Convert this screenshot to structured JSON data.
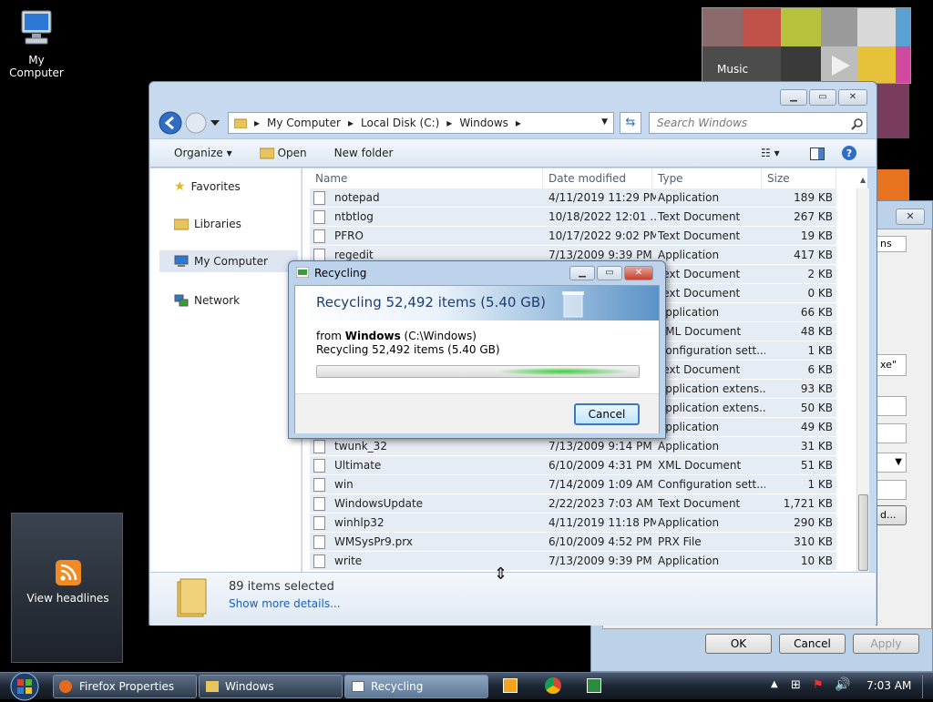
{
  "desktop": {
    "icons": [
      {
        "label": "My Computer"
      }
    ],
    "media_gadget": {
      "label": "Music"
    },
    "feed_gadget": {
      "label": "View headlines"
    }
  },
  "properties_window": {
    "tab_fragment": "ns",
    "field_fragment": "xe\"",
    "button_fragment": "d...",
    "ok_label": "OK",
    "cancel_label": "Cancel",
    "apply_label": "Apply"
  },
  "explorer": {
    "breadcrumb": [
      "My Computer",
      "Local Disk (C:)",
      "Windows"
    ],
    "search_placeholder": "Search Windows",
    "toolbar": {
      "organize_label": "Organize",
      "open_label": "Open",
      "new_folder_label": "New folder"
    },
    "nav_items": [
      {
        "label": "Favorites"
      },
      {
        "label": "Libraries"
      },
      {
        "label": "My Computer"
      },
      {
        "label": "Network"
      }
    ],
    "columns": [
      "Name",
      "Date modified",
      "Type",
      "Size"
    ],
    "rows": [
      {
        "name": "notepad",
        "date": "4/11/2019 11:29 PM",
        "type": "Application",
        "size": "189 KB"
      },
      {
        "name": "ntbtlog",
        "date": "10/18/2022 12:01 ...",
        "type": "Text Document",
        "size": "267 KB"
      },
      {
        "name": "PFRO",
        "date": "10/17/2022 9:02 PM",
        "type": "Text Document",
        "size": "19 KB"
      },
      {
        "name": "regedit",
        "date": "7/13/2009 9:39 PM",
        "type": "Application",
        "size": "417 KB"
      },
      {
        "name": "",
        "date": "",
        "type": "Text Document",
        "size": "2 KB"
      },
      {
        "name": "",
        "date": "",
        "type": "Text Document",
        "size": "0 KB"
      },
      {
        "name": "",
        "date": "",
        "type": "Application",
        "size": "66 KB"
      },
      {
        "name": "",
        "date": "",
        "type": "XML Document",
        "size": "48 KB"
      },
      {
        "name": "",
        "date": "",
        "type": "Configuration sett...",
        "size": "1 KB"
      },
      {
        "name": "",
        "date": "",
        "type": "Text Document",
        "size": "6 KB"
      },
      {
        "name": "",
        "date": "",
        "type": "Application extens...",
        "size": "93 KB"
      },
      {
        "name": "",
        "date": "",
        "type": "Application extens...",
        "size": "50 KB"
      },
      {
        "name": "",
        "date": "",
        "type": "Application",
        "size": "49 KB"
      },
      {
        "name": "twunk_32",
        "date": "7/13/2009 9:14 PM",
        "type": "Application",
        "size": "31 KB"
      },
      {
        "name": "Ultimate",
        "date": "6/10/2009 4:31 PM",
        "type": "XML Document",
        "size": "51 KB"
      },
      {
        "name": "win",
        "date": "7/14/2009 1:09 AM",
        "type": "Configuration sett...",
        "size": "1 KB"
      },
      {
        "name": "WindowsUpdate",
        "date": "2/22/2023 7:03 AM",
        "type": "Text Document",
        "size": "1,721 KB"
      },
      {
        "name": "winhlp32",
        "date": "4/11/2019 11:18 PM",
        "type": "Application",
        "size": "290 KB"
      },
      {
        "name": "WMSysPr9.prx",
        "date": "6/10/2009 4:52 PM",
        "type": "PRX File",
        "size": "310 KB"
      },
      {
        "name": "write",
        "date": "7/13/2009 9:39 PM",
        "type": "Application",
        "size": "10 KB"
      }
    ],
    "details": {
      "count": "89 items selected",
      "more_link": "Show more details..."
    }
  },
  "recycling_dialog": {
    "title": "Recycling",
    "heading": "Recycling 52,492 items (5.40 GB)",
    "from_prefix": "from ",
    "from_name": "Windows",
    "from_path": " (C:\\Windows)",
    "status": "Recycling 52,492 items (5.40 GB)",
    "cancel_label": "Cancel"
  },
  "taskbar": {
    "buttons": [
      {
        "label": "Firefox Properties"
      },
      {
        "label": "Windows"
      },
      {
        "label": "Recycling"
      }
    ],
    "clock": "7:03 AM"
  },
  "colors": {
    "accent": "#3b78c0",
    "progress": "#3ccf3c",
    "link": "#1a5fb4"
  }
}
